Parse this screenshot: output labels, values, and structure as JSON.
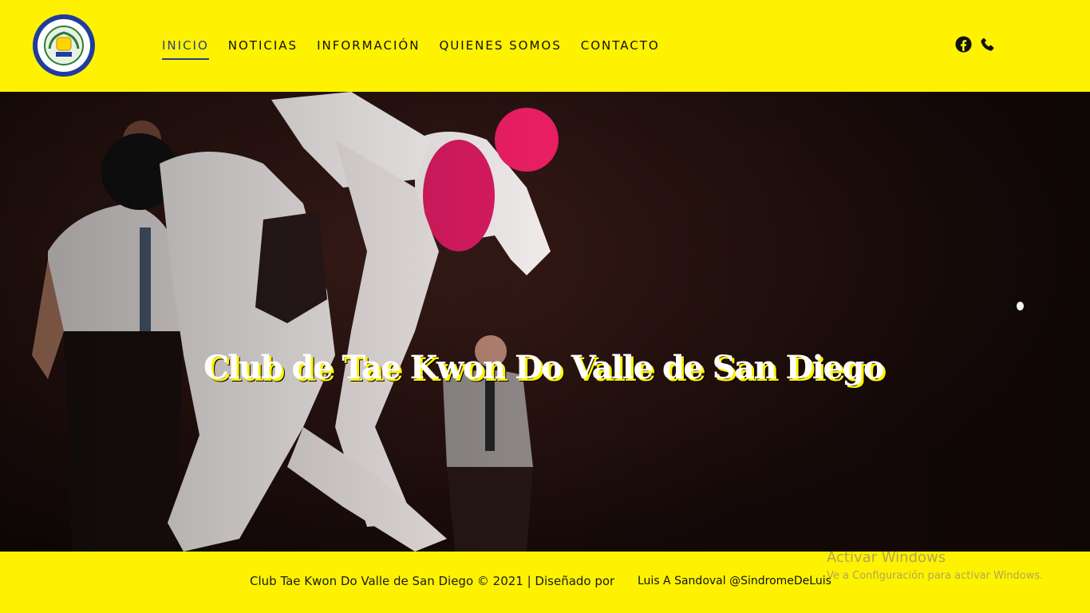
{
  "header": {
    "logo_icon": "club-crest-logo",
    "logo_top_text": "Moo Duk Kwan",
    "logo_ring_text": "Club de Tae KwonDo Valle de San Diego",
    "nav": [
      {
        "label": "INICIO",
        "active": true
      },
      {
        "label": "NOTICIAS",
        "active": false
      },
      {
        "label": "INFORMACIÓN",
        "active": false
      },
      {
        "label": "QUIENES SOMOS",
        "active": false
      },
      {
        "label": "CONTACTO",
        "active": false
      }
    ],
    "social": [
      "facebook-icon",
      "phone-icon"
    ],
    "colors": {
      "background": "#fff200",
      "active_nav": "#2a3e8e"
    }
  },
  "hero": {
    "title": "Club de Tae Kwon Do Valle de San Diego",
    "image": "taekwondo-sparring-photo"
  },
  "footer": {
    "copyright": "Club Tae Kwon Do Valle de San Diego © 2021 | Diseñado por",
    "credit": "Luis A Sandoval @SindromeDeLuis"
  },
  "watermark": {
    "title": "Activar Windows",
    "subtitle": "Ve a Configuración para activar Windows."
  }
}
